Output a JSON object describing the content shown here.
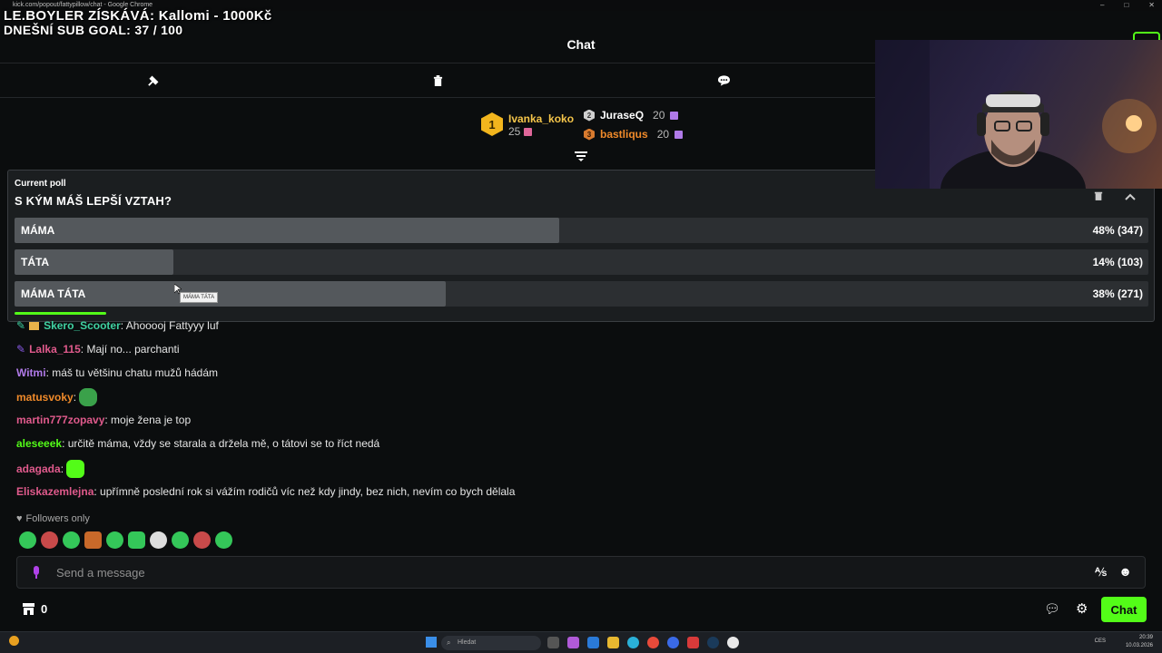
{
  "window": {
    "url": "kick.com/popout/fattypillow/chat - Google Chrome"
  },
  "overlay": {
    "line1": "LE.BOYLER ZÍSKÁVÁ: Kallomi - 1000Kč",
    "line2": "DNEŠNÍ SUB GOAL: 37 / 100"
  },
  "header": {
    "title": "Chat"
  },
  "leaderboard": {
    "first": {
      "rank": "1",
      "name": "Ivanka_koko",
      "points": "25"
    },
    "second": {
      "rank": "2",
      "name": "JuraseQ",
      "points": "20"
    },
    "third": {
      "rank": "3",
      "name": "bastliqus",
      "points": "20"
    }
  },
  "poll": {
    "label": "Current poll",
    "question": "S KÝM MÁŠ LEPŠÍ VZTAH?",
    "options": [
      {
        "label": "MÁMA",
        "value": "48% (347)",
        "percent": 48
      },
      {
        "label": "TÁTA",
        "value": "14% (103)",
        "percent": 14
      },
      {
        "label": "MÁMA TÁTA",
        "value": "38% (271)",
        "percent": 38
      }
    ],
    "tooltip": "MÁMA TÁTA"
  },
  "messages": [
    {
      "user": "Skero_Scooter",
      "color": "#3fd1a1",
      "text": ": Ahooooj Fattyyy luf"
    },
    {
      "user": "Lalka_115",
      "color": "#e05a8c",
      "text": ": Mají no... parchanti"
    },
    {
      "user": "Witmi",
      "color": "#b07ae8",
      "text": ": máš tu většinu chatu mužů hádám"
    },
    {
      "user": "matusvoky",
      "color": "#f08a2a",
      "text": ":"
    },
    {
      "user": "martin777zopavy",
      "color": "#e05a8c",
      "text": ": moje žena je top"
    },
    {
      "user": "aleseeek",
      "color": "#53fc18",
      "text": ": určitě máma, vždy se starala a držela mě, o tátovi se to říct nedá"
    },
    {
      "user": "adagada",
      "color": "#e05a8c",
      "text": ":"
    },
    {
      "user": "Eliskazemlejna",
      "color": "#e05a8c",
      "text": ": upřímně poslední rok si vážím rodičů víc než kdy jindy, bez nich, nevím co bych dělala"
    }
  ],
  "followers_only": "Followers only",
  "input": {
    "placeholder": "Send a message"
  },
  "bottom": {
    "count": "0",
    "chat_button": "Chat"
  },
  "taskbar": {
    "search_placeholder": "Hledat",
    "tray_lang": "CES",
    "time": "20:39",
    "date": "10.03.2026"
  },
  "colors": {
    "accent": "#53fc18",
    "background": "#0b0d0e",
    "poll_bg": "#1b1e20"
  }
}
